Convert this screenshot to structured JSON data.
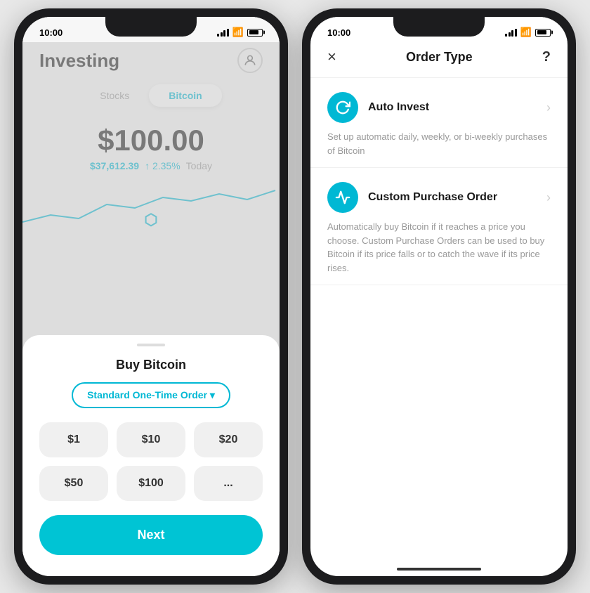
{
  "leftPhone": {
    "statusBar": {
      "time": "10:00"
    },
    "header": {
      "title": "Investing"
    },
    "tabs": [
      {
        "label": "Stocks",
        "active": false
      },
      {
        "label": "Bitcoin",
        "active": true
      }
    ],
    "price": {
      "amount": "$100.00",
      "btcPrice": "$37,612.39",
      "change": "↑ 2.35%",
      "period": "Today"
    },
    "bottomSheet": {
      "title": "Buy Bitcoin",
      "orderType": "Standard One-Time Order ▾",
      "amounts": [
        "$1",
        "$10",
        "$20",
        "$50",
        "$100",
        "..."
      ],
      "nextButton": "Next"
    }
  },
  "rightPhone": {
    "statusBar": {
      "time": "10:00"
    },
    "header": {
      "title": "Order Type",
      "closeLabel": "×",
      "helpLabel": "?"
    },
    "orderTypes": [
      {
        "name": "Auto Invest",
        "iconType": "refresh",
        "description": "Set up automatic daily, weekly, or bi-weekly purchases of Bitcoin"
      },
      {
        "name": "Custom Purchase Order",
        "iconType": "chart",
        "description": "Automatically buy Bitcoin if it reaches a price you choose. Custom Purchase Orders can be used to buy Bitcoin if its price falls or to catch the wave if its price rises."
      }
    ]
  }
}
